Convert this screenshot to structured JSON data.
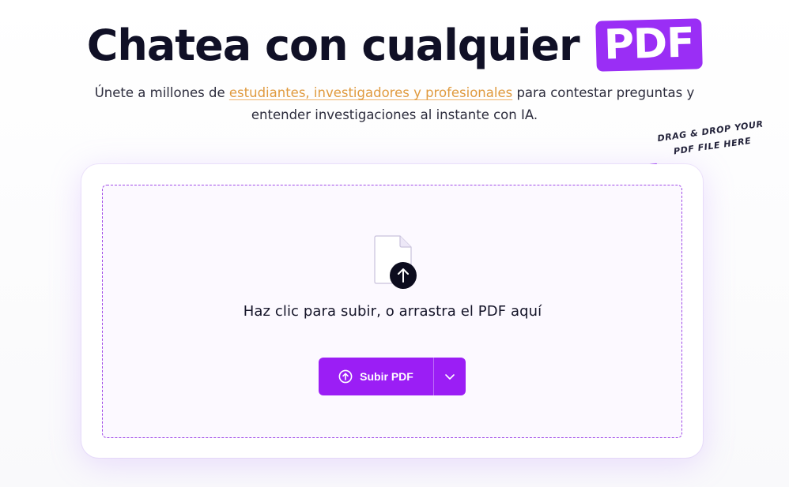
{
  "hero": {
    "title_main": "Chatea con cualquier",
    "title_highlight": "PDF",
    "subtitle_pre": "Únete a millones de ",
    "subtitle_link": "estudiantes, investigadores y profesionales",
    "subtitle_post": " para contestar preguntas y entender investigaciones al instante con IA."
  },
  "annotation": {
    "line1": "DRAG & DROP YOUR",
    "line2": "PDF FILE HERE"
  },
  "upload": {
    "prompt": "Haz clic para subir, o arrastra el PDF aquí",
    "button_label": "Subir PDF",
    "icons": {
      "file": "document-upload-icon",
      "button": "upload-circle-icon",
      "dropdown": "chevron-down-icon",
      "annotation": "curved-arrow-icon"
    }
  },
  "colors": {
    "accent": "#9b1ef5",
    "highlight_link": "#e09a3e",
    "title": "#101026"
  }
}
